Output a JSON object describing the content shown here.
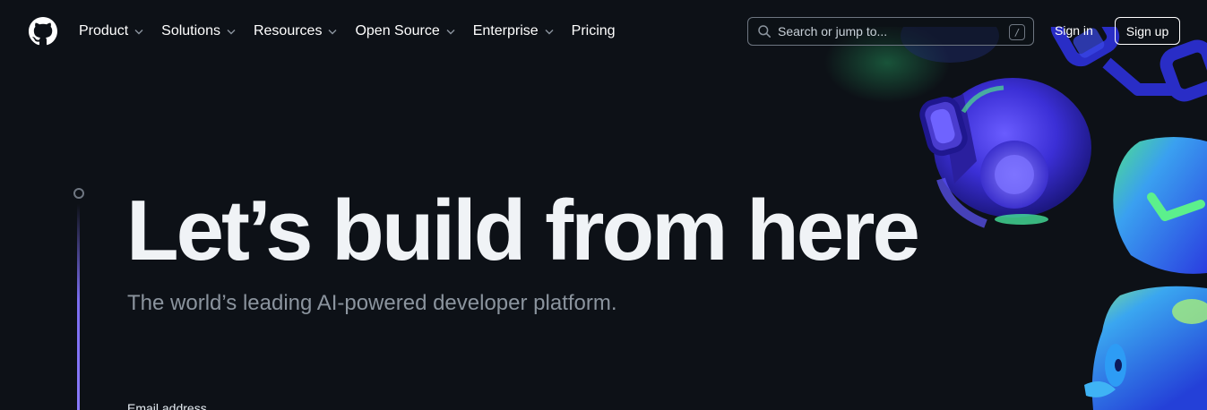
{
  "header": {
    "logo_icon": "github-mark-icon",
    "nav": [
      {
        "label": "Product",
        "has_dropdown": true
      },
      {
        "label": "Solutions",
        "has_dropdown": true
      },
      {
        "label": "Resources",
        "has_dropdown": true
      },
      {
        "label": "Open Source",
        "has_dropdown": true
      },
      {
        "label": "Enterprise",
        "has_dropdown": true
      },
      {
        "label": "Pricing",
        "has_dropdown": false
      }
    ],
    "search": {
      "placeholder": "Search or jump to...",
      "shortcut": "/",
      "icon": "search-icon"
    },
    "signin_label": "Sign in",
    "signup_label": "Sign up"
  },
  "hero": {
    "title": "Let’s build from here",
    "subtitle": "The world’s leading AI-powered developer platform.",
    "email_label": "Email address"
  },
  "colors": {
    "background": "#0d1117",
    "accent": "#7c6ff2",
    "muted_text": "#8b949e"
  }
}
